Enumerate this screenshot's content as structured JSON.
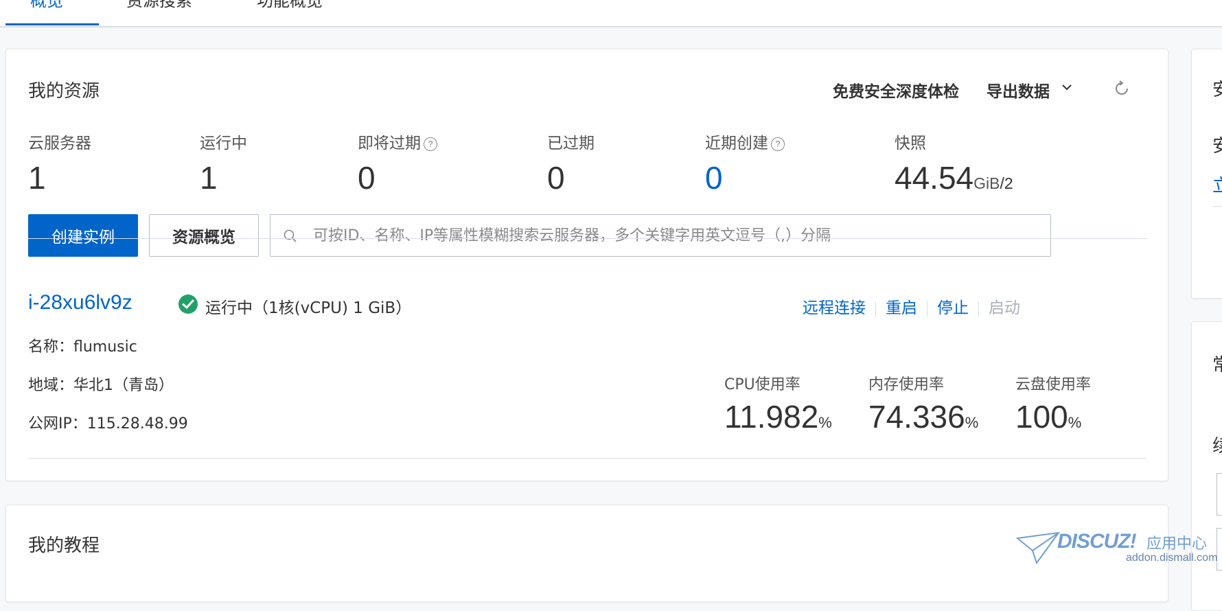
{
  "tabs": [
    {
      "label": "概览",
      "active": true
    },
    {
      "label": "资源搜索",
      "active": false
    },
    {
      "label": "功能概览",
      "active": false
    }
  ],
  "resources": {
    "title": "我的资源",
    "free_check": "免费安全深度体检",
    "export": "导出数据",
    "stats": [
      {
        "label": "云服务器",
        "value": "1"
      },
      {
        "label": "运行中",
        "value": "1"
      },
      {
        "label": "即将过期",
        "value": "0",
        "help": "?"
      },
      {
        "label": "已过期",
        "value": "0"
      },
      {
        "label": "近期创建",
        "value": "0",
        "help": "?"
      },
      {
        "label": "快照",
        "value": "44.54",
        "unit": "GiB",
        "suffix": "/2"
      }
    ],
    "create_button": "创建实例",
    "overview_button": "资源概览",
    "search_placeholder": "可按ID、名称、IP等属性模糊搜索云服务器，多个关键字用英文逗号（,）分隔"
  },
  "instance": {
    "id": "i-28xu6lv9z",
    "status": "运行中（1核(vCPU) 1 GiB）",
    "actions": {
      "remote": "远程连接",
      "restart": "重启",
      "stop": "停止",
      "start": "启动"
    },
    "name_label": "名称：flumusic",
    "region_label": "地域：华北1（青岛）",
    "ip_label": "公网IP：115.28.48.99",
    "metrics": [
      {
        "label": "CPU使用率",
        "value": "11.982",
        "unit": "%"
      },
      {
        "label": "内存使用率",
        "value": "74.336",
        "unit": "%"
      },
      {
        "label": "云盘使用率",
        "value": "100",
        "unit": "%"
      }
    ]
  },
  "tutorial": {
    "title": "我的教程"
  },
  "side": {
    "r1_title": "安",
    "r1_sub": "安",
    "r1_link": "立",
    "r2_title": "常",
    "r2_sub": "续"
  },
  "watermark": {
    "brand": "DISCUZ!",
    "cn": "应用中心",
    "url": "addon.dismall.com"
  },
  "colors": {
    "primary": "#0064c8",
    "success": "#22a06b",
    "disabled": "#aab0b8"
  }
}
